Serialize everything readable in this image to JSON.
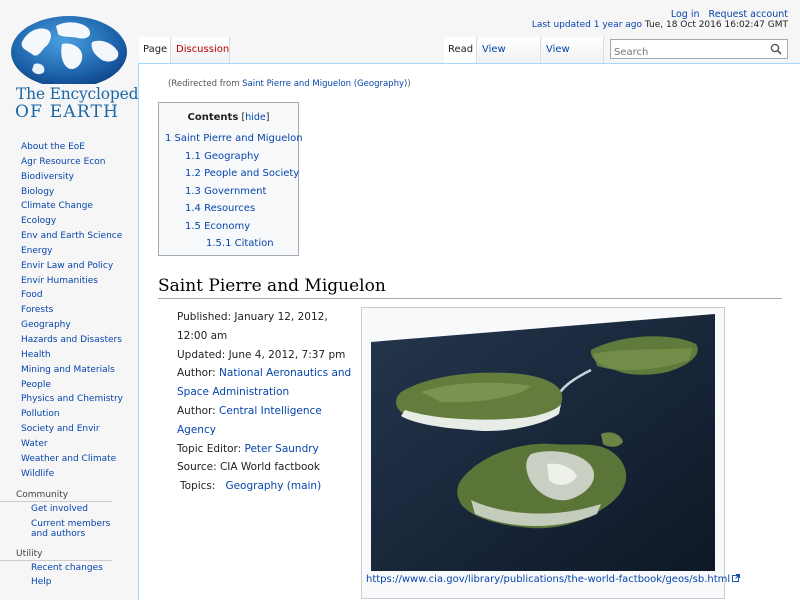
{
  "logo": {
    "line1": "The Encyclopedia",
    "line2": "OF EARTH"
  },
  "sidebar": {
    "items": [
      "About the EoE",
      "Agr Resource Econ",
      "Biodiversity",
      "Biology",
      "Climate Change",
      "Ecology",
      "Env and Earth Science",
      "Energy",
      "Envir Law and Policy",
      "Envir Humanities",
      "Food",
      "Forests",
      "Geography",
      "Hazards and Disasters",
      "Health",
      "Mining and Materials",
      "People",
      "Physics and Chemistry",
      "Pollution",
      "Society and Envir",
      "Water",
      "Weather and Climate",
      "Wildlife"
    ],
    "community": {
      "title": "Community",
      "items": [
        "Get involved",
        "Current members and authors"
      ]
    },
    "utility": {
      "title": "Utility",
      "items": [
        "Recent changes",
        "Help"
      ]
    }
  },
  "personal": {
    "login": "Log in",
    "request": "Request account"
  },
  "last_updated": {
    "link": "Last updated 1 year ago",
    "date": "Tue, 18 Oct 2016 16:02:47 GMT"
  },
  "tabs": {
    "page": "Page",
    "discussion": "Discussion",
    "read": "Read",
    "view_source": "View source",
    "view_history": "View history"
  },
  "search": {
    "placeholder": "Search"
  },
  "redirect": {
    "prefix": "(Redirected from ",
    "link": "Saint Pierre and Miguelon (Geography)",
    "suffix": ")"
  },
  "toc": {
    "title": "Contents",
    "hide": "hide",
    "items": [
      "1 Saint Pierre and Miguelon",
      "1.1 Geography",
      "1.2 People and Society",
      "1.3 Government",
      "1.4 Resources",
      "1.5 Economy",
      "1.5.1 Citation"
    ]
  },
  "heading": "Saint Pierre and Miguelon",
  "meta": {
    "published": "Published: January 12, 2012, 12:00 am",
    "updated": "Updated: June 4, 2012, 7:37 pm",
    "author_label": "Author: ",
    "author1": "National Aeronautics and Space Administration",
    "author2": "Central Intelligence Agency",
    "editor_label": "Topic Editor: ",
    "editor": "Peter Saundry",
    "source": "Source: CIA World factbook",
    "topics_label": "Topics:",
    "topics": "Geography (main)"
  },
  "thumb": {
    "caption": "https://www.cia.gov/library/publications/the-world-factbook/geos/sb.html"
  },
  "colors": {
    "link": "#0645ad",
    "logo": "#1b67a8",
    "ocean": "#152234"
  }
}
